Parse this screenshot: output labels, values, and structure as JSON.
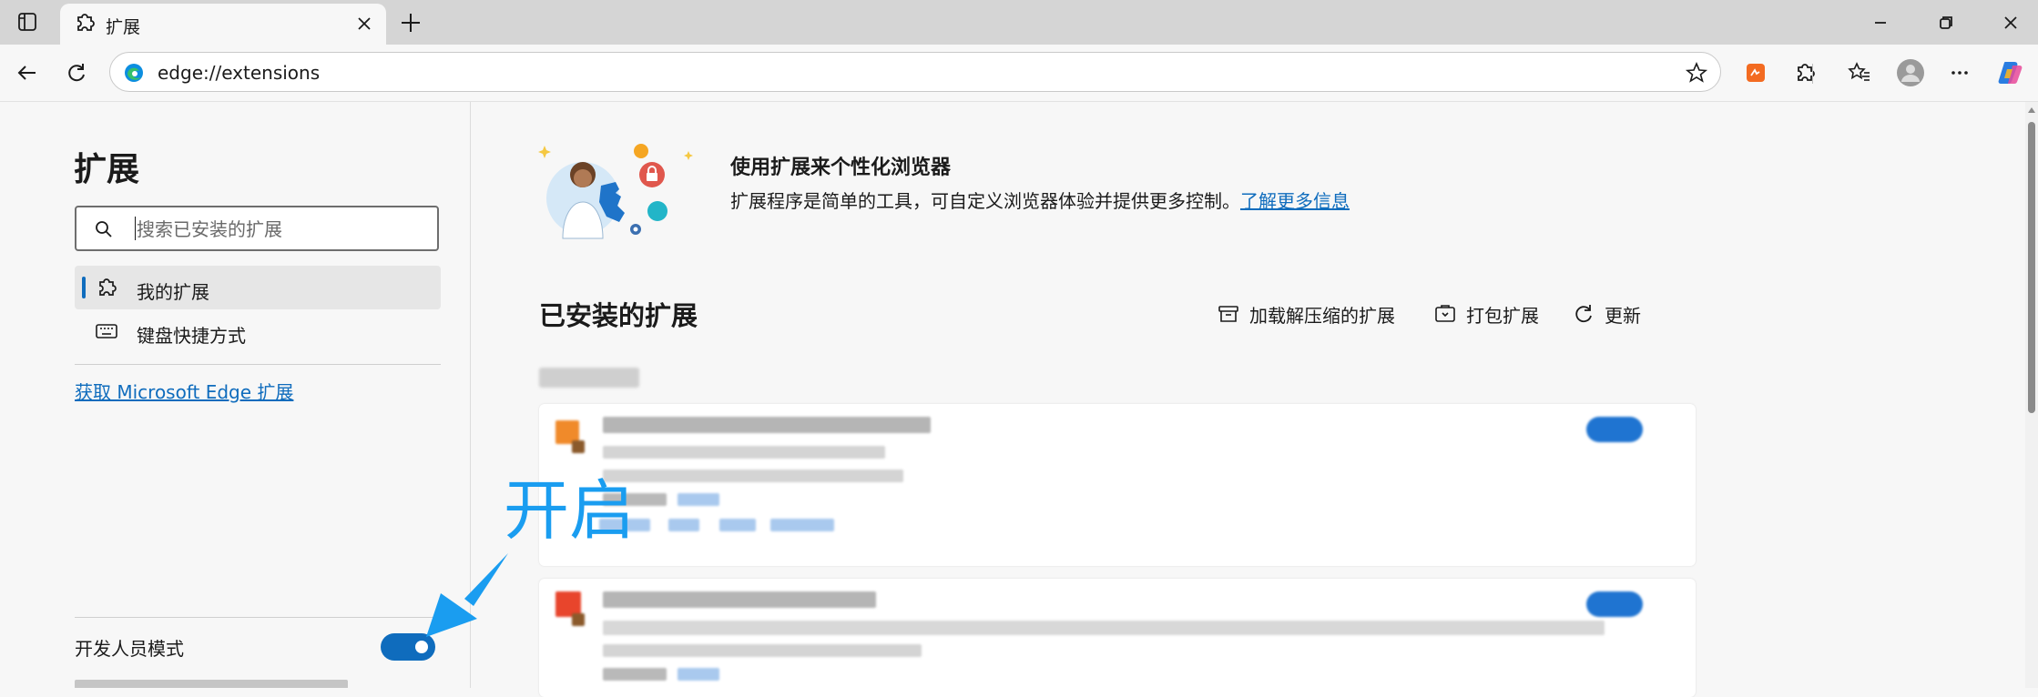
{
  "browser": {
    "tab_title": "扩展",
    "address": "edge://extensions",
    "icons": {
      "sidebar_toggle": "tab-actions-icon",
      "tab": "puzzle-gear-icon",
      "close_tab": "close-icon",
      "new_tab": "plus-icon",
      "back": "back-arrow-icon",
      "refresh": "refresh-icon",
      "favorite": "star-icon",
      "toolbar_extensions": [
        "orange-extension-icon",
        "puzzle-icon",
        "favorites-icon",
        "profile-icon",
        "more-icon",
        "copilot-icon"
      ],
      "window_controls": [
        "minimize-icon",
        "restore-icon",
        "close-window-icon"
      ]
    }
  },
  "sidebar": {
    "title": "扩展",
    "search_placeholder": "搜索已安装的扩展",
    "items": [
      {
        "label": "我的扩展",
        "active": true,
        "icon": "puzzle-gear-icon"
      },
      {
        "label": "键盘快捷方式",
        "active": false,
        "icon": "keyboard-icon"
      }
    ],
    "get_link": "获取 Microsoft Edge 扩展",
    "developer_mode_label": "开发人员模式",
    "developer_mode_on": true
  },
  "main": {
    "hero_title": "使用扩展来个性化浏览器",
    "hero_desc": "扩展程序是简单的工具，可自定义浏览器体验并提供更多控制。",
    "hero_link": "了解更多信息",
    "installed_title": "已安装的扩展",
    "actions": {
      "load_unpacked": "加载解压缩的扩展",
      "pack": "打包扩展",
      "update": "更新"
    }
  },
  "annotation": {
    "text": "开启",
    "color": "#1a9df0"
  },
  "colors": {
    "accent": "#0f6cbd",
    "titlebar": "#d5d5d5",
    "background": "#f7f7f7"
  }
}
